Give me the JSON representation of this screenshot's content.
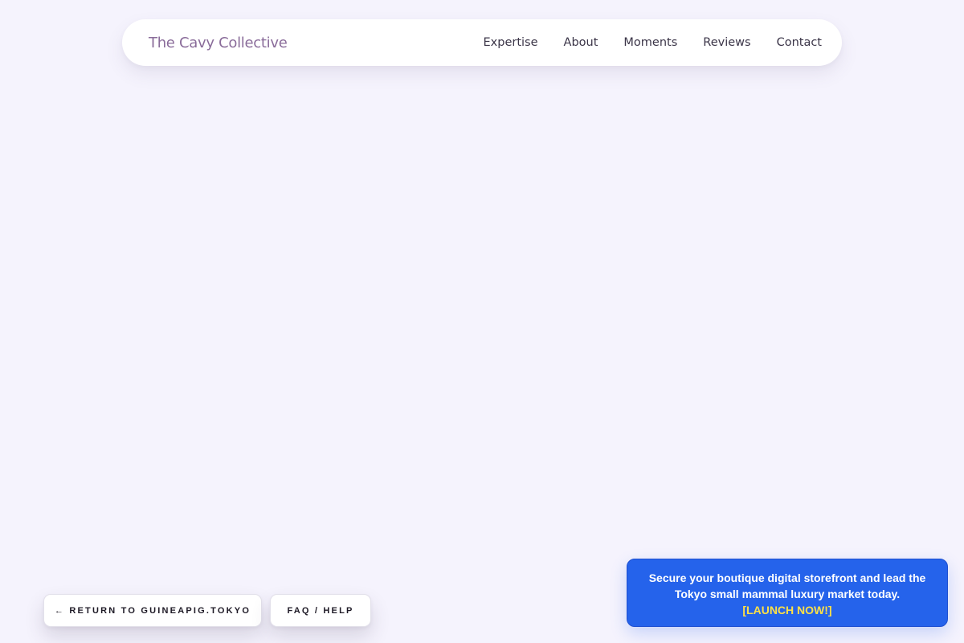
{
  "header": {
    "brand": "The Cavy Collective",
    "nav": [
      {
        "label": "Expertise"
      },
      {
        "label": "About"
      },
      {
        "label": "Moments"
      },
      {
        "label": "Reviews"
      },
      {
        "label": "Contact"
      }
    ]
  },
  "footer_actions": {
    "return_label": "← RETURN TO GUINEAPIG.TOKYO",
    "faq_label": "FAQ / HELP"
  },
  "promo": {
    "message": "Secure your boutique digital storefront and lead the Tokyo small mammal luxury market today.",
    "cta": "[LAUNCH NOW!]",
    "colors": {
      "background": "#2563eb",
      "text": "#ffffff",
      "cta": "#fde047"
    }
  },
  "colors": {
    "page_background": "#f5f3fd",
    "brand": "#8a6c9a",
    "nav_text": "#3b3548"
  }
}
